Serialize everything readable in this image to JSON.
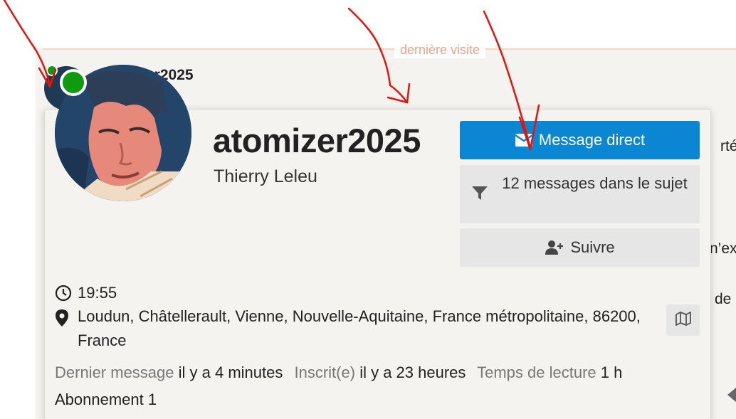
{
  "background": {
    "top_rule_label": "dernière visite",
    "username_fragment": "er2025",
    "side_fragments": [
      "rtée",
      "n’ex",
      "de"
    ]
  },
  "profile": {
    "username": "atomizer2025",
    "full_name": "Thierry Leleu",
    "status": "online",
    "avatar_icon": "profile-photo"
  },
  "actions": {
    "direct_message": {
      "label": "Message direct",
      "icon": "envelope-icon"
    },
    "filter_messages": {
      "label": "12 messages dans le sujet",
      "icon": "filter-icon"
    },
    "follow": {
      "label": "Suivre",
      "icon": "user-plus-icon"
    }
  },
  "info": {
    "local_time": "19:55",
    "location": "Loudun, Châtellerault, Vienne, Nouvelle-Aquitaine, France métropolitaine, 86200, France",
    "map_icon": "map-icon"
  },
  "stats": [
    {
      "label": "Dernier message",
      "value": "il y a 4 minutes"
    },
    {
      "label": "Inscrit(e)",
      "value": "il y a 23 heures"
    },
    {
      "label": "Temps de lecture",
      "value": "1 h"
    }
  ],
  "subscriptions": "Abonnement 1",
  "colors": {
    "primary": "#0a86d2",
    "online": "#0f9b0f",
    "annotation": "#e8120c"
  }
}
